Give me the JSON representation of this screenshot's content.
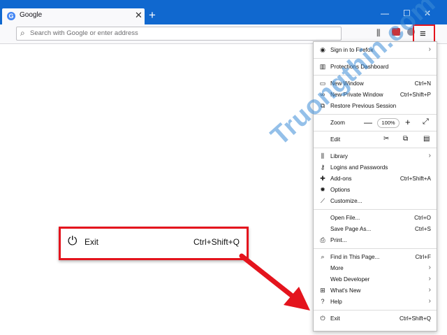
{
  "tab": {
    "title": "Google",
    "favicon_letter": "G",
    "close": "✕"
  },
  "new_tab": "+",
  "window_controls": {
    "minimize": "—",
    "maximize": "☐",
    "close": "✕"
  },
  "urlbar": {
    "placeholder": "Search with Google or enter address"
  },
  "menu": {
    "sign_in": "Sign in to Firefox",
    "protections": "Protections Dashboard",
    "new_window": {
      "label": "New Window",
      "shortcut": "Ctrl+N"
    },
    "private_window": {
      "label": "New Private Window",
      "shortcut": "Ctrl+Shift+P"
    },
    "restore_session": "Restore Previous Session",
    "zoom": {
      "label": "Zoom",
      "minus": "—",
      "value": "100%",
      "plus": "+",
      "fullscreen": "⤢"
    },
    "edit": {
      "label": "Edit"
    },
    "library": "Library",
    "logins": "Logins and Passwords",
    "addons": {
      "label": "Add-ons",
      "shortcut": "Ctrl+Shift+A"
    },
    "options": "Options",
    "customize": "Customize...",
    "open_file": {
      "label": "Open File...",
      "shortcut": "Ctrl+O"
    },
    "save_page": {
      "label": "Save Page As...",
      "shortcut": "Ctrl+S"
    },
    "print": "Print...",
    "find": {
      "label": "Find in This Page...",
      "shortcut": "Ctrl+F"
    },
    "more": "More",
    "web_developer": "Web Developer",
    "whats_new": "What's New",
    "help": "Help",
    "exit": {
      "label": "Exit",
      "shortcut": "Ctrl+Shift+Q"
    }
  },
  "callout": {
    "label": "Exit",
    "shortcut": "Ctrl+Shift+Q"
  },
  "watermark": "Truongthin.com",
  "colors": {
    "tabstrip": "#1068cf",
    "highlight": "#e4141d",
    "watermark": "#3c8cd7"
  }
}
